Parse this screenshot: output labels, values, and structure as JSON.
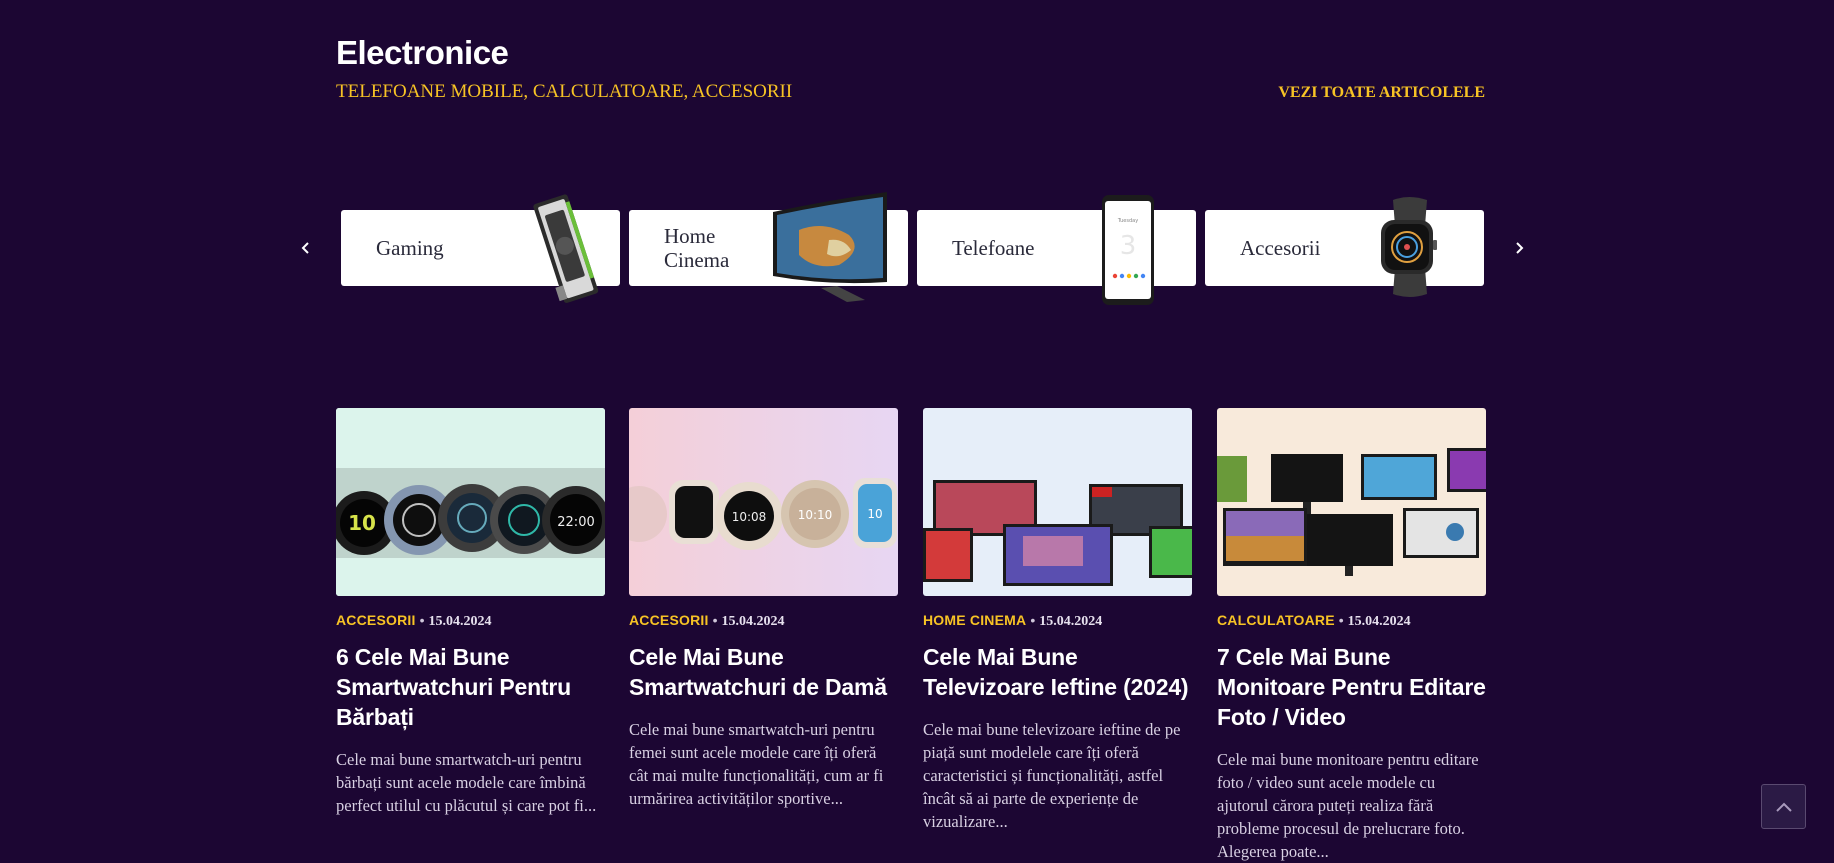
{
  "section": {
    "title": "Electronice",
    "subcategories": [
      "TELEFOANE MOBILE",
      "CALCULATOARE",
      "ACCESORII"
    ],
    "view_all": "VEZI TOATE ARTICOLELE"
  },
  "carousel": {
    "prev_icon": "chevron-left-icon",
    "next_icon": "chevron-right-icon",
    "items": [
      {
        "label": "Gaming",
        "image": "graphics-card"
      },
      {
        "label": "Home Cinema",
        "image": "curved-tv"
      },
      {
        "label": "Telefoane",
        "image": "smartphone"
      },
      {
        "label": "Accesorii",
        "image": "smartwatch"
      }
    ]
  },
  "articles": [
    {
      "category": "ACCESORII",
      "date": "15.04.2024",
      "title": "6 Cele Mai Bune Smartwatchuri Pentru Bărbați",
      "excerpt": "Cele mai bune smartwatch-uri pentru bărbați sunt acele modele care îmbină perfect utilul cu plăcutul și care pot fi...",
      "image": "men-smartwatches"
    },
    {
      "category": "ACCESORII",
      "date": "15.04.2024",
      "title": "Cele Mai Bune Smartwatchuri de Damă",
      "excerpt": "Cele mai bune smartwatch-uri pentru femei sunt acele modele care îți oferă cât mai multe funcționalități, cum ar fi urmărirea activităților sportive...",
      "image": "women-smartwatches"
    },
    {
      "category": "HOME CINEMA",
      "date": "15.04.2024",
      "title": "Cele Mai Bune Televizoare Ieftine (2024)",
      "excerpt": "Cele mai bune televizoare ieftine de pe piață sunt modelele care îți oferă caracteristici și funcționalități, astfel încât să ai parte de experiențe de vizualizare...",
      "image": "cheap-tvs"
    },
    {
      "category": "CALCULATOARE",
      "date": "15.04.2024",
      "title": "7 Cele Mai Bune Monitoare Pentru Editare Foto / Video",
      "excerpt": "Cele mai bune monitoare pentru editare foto / video sunt acele modele cu ajutorul cărora puteți realiza fără probleme procesul de prelucrare foto. Alegerea poate...",
      "image": "monitors"
    }
  ],
  "scroll_top_icon": "chevron-up-icon",
  "colors": {
    "background": "#1c0633",
    "accent": "#f7c325"
  }
}
